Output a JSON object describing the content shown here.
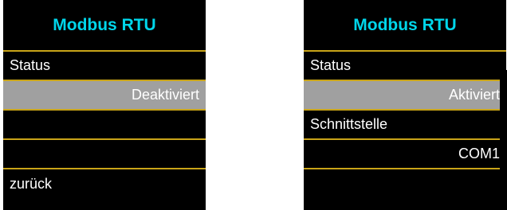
{
  "colors": {
    "background": "#000000",
    "title": "#00d6ea",
    "divider": "#c9a418",
    "selected": "#a0a0a0",
    "text": "#ffffff"
  },
  "left_panel": {
    "title": "Modbus RTU",
    "rows": [
      {
        "label": "Status"
      },
      {
        "label": "Deaktiviert"
      },
      {
        "label": ""
      },
      {
        "label": ""
      },
      {
        "label": "zurück"
      }
    ]
  },
  "right_panel": {
    "title": "Modbus RTU",
    "rows": [
      {
        "label": "Status"
      },
      {
        "label": "Aktiviert"
      },
      {
        "label": "Schnittstelle"
      },
      {
        "label": "COM1"
      },
      {
        "label": ""
      }
    ]
  }
}
